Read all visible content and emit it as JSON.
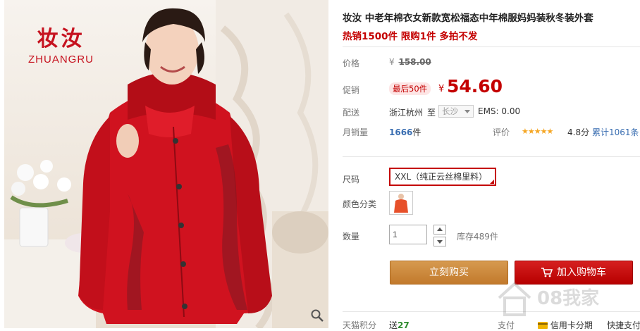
{
  "brand": {
    "name_zh": "妆汝",
    "name_en": "ZHUANGRU"
  },
  "product": {
    "title": "妆汝 中老年棉衣女新款宽松福态中年棉服妈妈装秋冬装外套",
    "promo": "热销1500件 限购1件 多拍不发"
  },
  "price": {
    "label": "价格",
    "currency": "¥",
    "original": "158.00"
  },
  "promotion": {
    "label": "促销",
    "badge": "最后50件",
    "currency": "¥",
    "price": "54.60"
  },
  "shipping": {
    "label": "配送",
    "from": "浙江杭州",
    "to_label": "至",
    "city": "长沙",
    "ems": "EMS: 0.00"
  },
  "sales": {
    "label": "月销量",
    "count": "1666",
    "unit": "件",
    "rating_label": "评价",
    "stars": "★★★★★",
    "score": "4.8分",
    "review_count": "累计1061条"
  },
  "options": {
    "size_label": "尺码",
    "size_value": "XXL（纯正云丝棉里料）",
    "color_label": "颜色分类"
  },
  "quantity": {
    "label": "数量",
    "value": "1",
    "stock": "库存489件"
  },
  "actions": {
    "buy_now": "立刻购买",
    "add_to_cart": "加入购物车"
  },
  "footer": {
    "points_label": "天猫积分",
    "points_prefix": "送",
    "points_value": "27",
    "pay_label": "支付",
    "credit_label": "信用卡分期",
    "quick_pay": "快捷支付"
  },
  "watermark": {
    "text": "08我家"
  },
  "colors": {
    "accent_red": "#c40000",
    "buy_orange": "#c98434",
    "link_blue": "#3a6eb1",
    "star_gold": "#f5a623"
  }
}
